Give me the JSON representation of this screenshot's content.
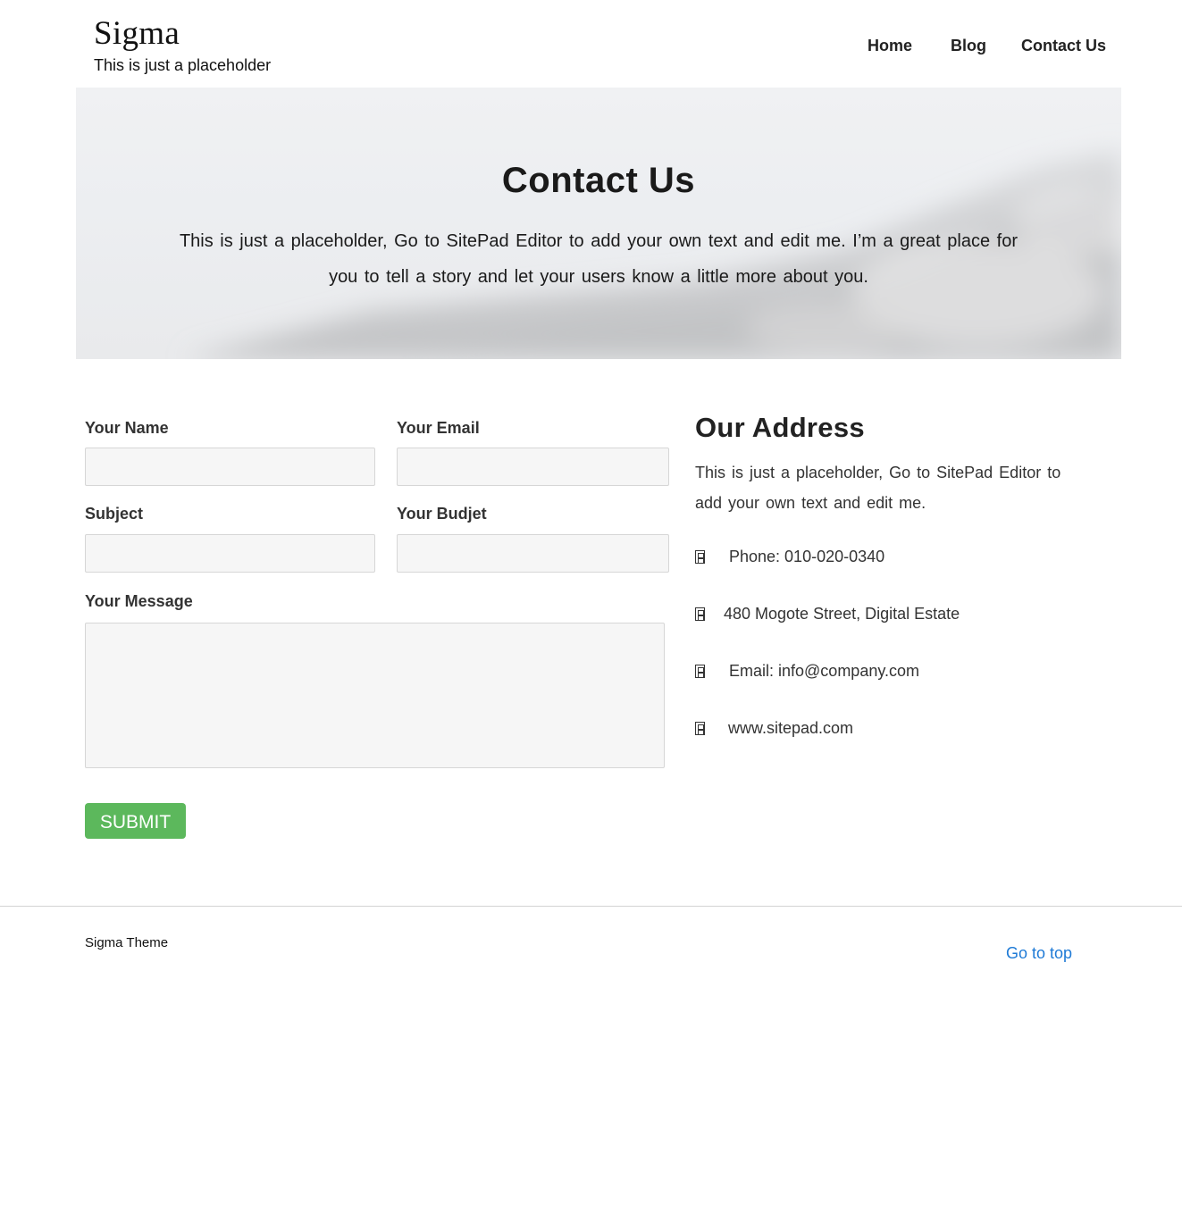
{
  "header": {
    "site_title": "Sigma",
    "tagline": "This is just a placeholder",
    "nav": {
      "home": "Home",
      "blog": "Blog",
      "contact": "Contact Us"
    }
  },
  "hero": {
    "title": "Contact Us",
    "text": "This is just a placeholder,  Go to SitePad Editor to add your own text and edit me. I’m a great place for you to tell a story and let your users know a little more about you."
  },
  "form": {
    "name_label": "Your Name",
    "name_value": "",
    "email_label": "Your Email",
    "email_value": "",
    "subject_label": "Subject",
    "subject_value": "",
    "budget_label": "Your Budjet",
    "budget_value": "",
    "message_label": "Your Message",
    "message_value": "",
    "submit_label": "SUBMIT"
  },
  "address": {
    "title": "Our Address",
    "text": "This is just a placeholder,  Go to SitePad Editor to add your own text and edit me.",
    "phone": "Phone: 010-020-0340",
    "street": "480 Mogote Street, Digital Estate",
    "email": "Email: info@company.com",
    "website": "www.sitepad.com"
  },
  "footer": {
    "brand": "Sigma Theme",
    "go_top": "Go to top"
  },
  "colors": {
    "submit": "#5cb85c",
    "link": "#1e7ad6"
  },
  "icons": {
    "phone": "phone-icon",
    "location": "location-icon",
    "email": "email-icon",
    "website": "globe-icon"
  }
}
